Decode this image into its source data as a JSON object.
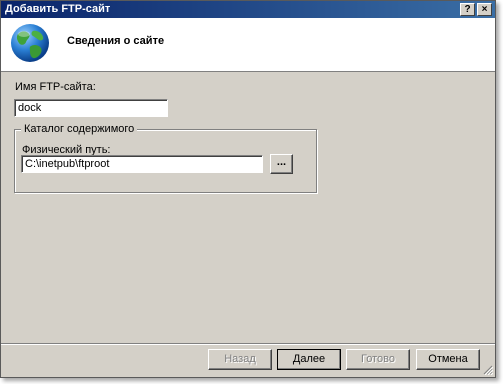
{
  "window": {
    "title": "Добавить FTP-сайт",
    "help_glyph": "?",
    "close_glyph": "×"
  },
  "header": {
    "title": "Сведения о сайте",
    "icon": "globe-icon"
  },
  "form": {
    "site_name_label": "Имя FTP-сайта:",
    "site_name_value": "dock",
    "content_group_label": "Каталог содержимого",
    "physical_path_label": "Физический путь:",
    "physical_path_value": "C:\\inetpub\\ftproot",
    "browse_label": "..."
  },
  "buttons": {
    "back": "Назад",
    "next": "Далее",
    "finish": "Готово",
    "cancel": "Отмена"
  },
  "colors": {
    "titlebar": "#0a246a",
    "face": "#d4d0c8",
    "header_bg": "#ffffff"
  }
}
